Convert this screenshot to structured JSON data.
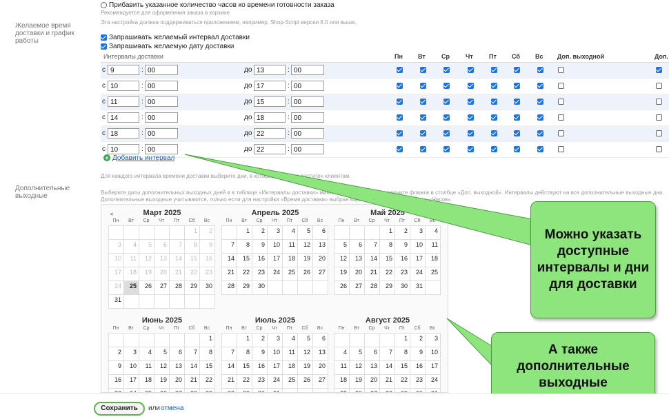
{
  "top": {
    "radio_label": "Прибавить указанное количество часов ко времени готовности заказа",
    "radio_hint": "Рекомендуется для оформления заказа в корзине"
  },
  "note_top": "Эта настройка должна поддерживаться приложением, например, Shop-Script версии 8.0 или выше.",
  "section_delivery_label": "Желаемое время доставки и график работы",
  "opt_interval": "Запрашивать желаемый интервал доставки",
  "opt_date": "Запрашивать желаемую дату доставки",
  "intervals": {
    "header": "Интервалы доставки",
    "days": [
      "Пн",
      "Вт",
      "Ср",
      "Чт",
      "Пт",
      "Сб",
      "Вс"
    ],
    "extra_day": "Доп. выходной",
    "extra_day_cut": "Доп.",
    "from": "с",
    "to": "до",
    "colon": ":",
    "rows": [
      {
        "from_h": "9",
        "from_m": "00",
        "to_h": "13",
        "to_m": "00",
        "days": [
          true,
          true,
          true,
          true,
          true,
          true,
          true
        ],
        "extra": false,
        "extra2": true
      },
      {
        "from_h": "10",
        "from_m": "00",
        "to_h": "17",
        "to_m": "00",
        "days": [
          true,
          true,
          true,
          true,
          true,
          true,
          true
        ],
        "extra": false,
        "extra2": false
      },
      {
        "from_h": "11",
        "from_m": "00",
        "to_h": "15",
        "to_m": "00",
        "days": [
          true,
          true,
          true,
          true,
          true,
          true,
          true
        ],
        "extra": false,
        "extra2": false
      },
      {
        "from_h": "14",
        "from_m": "00",
        "to_h": "18",
        "to_m": "00",
        "days": [
          true,
          true,
          true,
          true,
          true,
          true,
          true
        ],
        "extra": false,
        "extra2": false
      },
      {
        "from_h": "18",
        "from_m": "00",
        "to_h": "22",
        "to_m": "00",
        "days": [
          true,
          true,
          true,
          true,
          true,
          true,
          true
        ],
        "extra": false,
        "extra2": false
      },
      {
        "from_h": "10",
        "from_m": "00",
        "to_h": "22",
        "to_m": "00",
        "days": [
          true,
          true,
          true,
          true,
          true,
          true,
          true
        ],
        "extra": false,
        "extra2": false
      }
    ],
    "add_link": "Добавить интервал",
    "hint": "Для каждого интервала времени доставки выберите дни, в которые он будет доступен клиентам."
  },
  "section_holidays_label": "Дополнительные выходные",
  "holidays_hint1": "Выберите даты дополнительных выходных дней в в таблице «Интервалы доставки» минимум один интервал включите флажок в столбце «Доп. выходной». Интервалы действуют на все дополнительные выходные дни.",
  "holidays_hint2": "Дополнительные выходные учитываются, только если для настройки «Время доставки» выбран вариант «Предлагать выбор», «Часов».",
  "calendar": {
    "prev": "◂",
    "weekdays": [
      "Пн",
      "Вт",
      "Ср",
      "Чт",
      "Пт",
      "Сб",
      "Вс"
    ],
    "months": [
      {
        "title": "Март 2025",
        "offset": 5,
        "days": 31,
        "dim_until": 24,
        "today": 25
      },
      {
        "title": "Апрель 2025",
        "offset": 1,
        "days": 30,
        "dim_until": 0,
        "today": 0
      },
      {
        "title": "Май 2025",
        "offset": 3,
        "days": 31,
        "dim_until": 0,
        "today": 0
      },
      {
        "title": "Июнь 2025",
        "offset": 6,
        "days": 30,
        "dim_until": 0,
        "today": 0
      },
      {
        "title": "Июль 2025",
        "offset": 1,
        "days": 31,
        "dim_until": 0,
        "today": 0
      },
      {
        "title": "Август 2025",
        "offset": 4,
        "days": 31,
        "dim_until": 0,
        "today": 0
      }
    ]
  },
  "callout1": "Можно указать доступные интервалы и дни для доставки",
  "callout2": "А также дополнительные выходные",
  "footer": {
    "save": "Сохранить",
    "or": "или",
    "cancel": "отмена"
  }
}
